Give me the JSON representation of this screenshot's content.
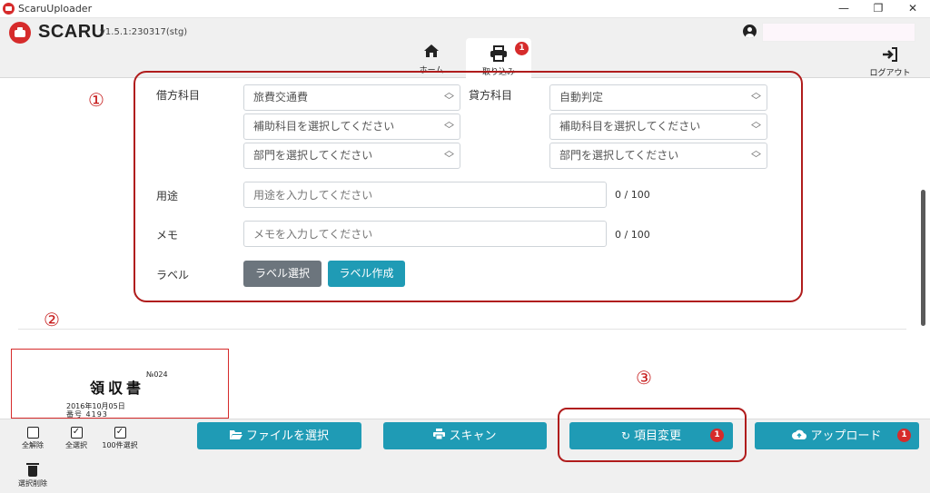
{
  "window": {
    "title": "ScaruUploader",
    "minimize": "—",
    "restore": "❐",
    "close": "✕"
  },
  "header": {
    "logo": "SCARU",
    "version": "v1.5.1:230317(stg)",
    "tabs": [
      {
        "label": "ホーム",
        "icon": "home-icon"
      },
      {
        "label": "取り込み",
        "icon": "printer-icon",
        "badge": "1"
      }
    ],
    "logout_label": "ログアウト"
  },
  "form": {
    "debit_label": "借方科目",
    "credit_label": "貸方科目",
    "debit": {
      "account": "旅費交通費",
      "sub_account": "補助科目を選択してください",
      "department": "部門を選択してください"
    },
    "credit": {
      "account": "自動判定",
      "sub_account": "補助科目を選択してください",
      "department": "部門を選択してください"
    },
    "purpose_label": "用途",
    "purpose_placeholder": "用途を入力してください",
    "purpose_count": "0 / 100",
    "memo_label": "メモ",
    "memo_placeholder": "メモを入力してください",
    "memo_count": "0 / 100",
    "label_label": "ラベル",
    "label_select_button": "ラベル選択",
    "label_create_button": "ラベル作成"
  },
  "annotations": [
    "①",
    "②",
    "③"
  ],
  "receipt": {
    "title": "領収書",
    "number": "№024",
    "date": "2016年10月05日",
    "code": "番号  4193"
  },
  "bottom": {
    "deselect_all": "全解除",
    "select_all": "全選択",
    "select_100": "100件選択",
    "delete_selected": "選択削除",
    "choose_file": "ファイルを選択",
    "scan": "スキャン",
    "change_items": "項目変更",
    "change_items_badge": "1",
    "upload": "アップロード",
    "upload_badge": "1"
  },
  "colors": {
    "brand_red": "#d62b2b",
    "teal": "#1f9bb5",
    "gray_button": "#6c757d",
    "annotation_red": "#b01c1c"
  }
}
